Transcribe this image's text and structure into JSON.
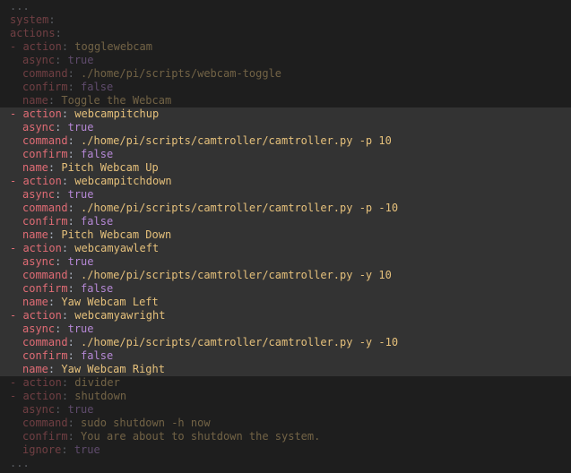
{
  "colors": {
    "background": "#1e1e1e",
    "highlight": "#333333",
    "key": "#e06c75",
    "string": "#e5c07b",
    "boolean": "#b688d6",
    "punctuation": "#abb2bf"
  },
  "lines": [
    {
      "kind": "plain",
      "text": "...",
      "dim": true
    },
    {
      "kind": "key",
      "indent": 0,
      "dash": false,
      "key": "system",
      "value": "",
      "vtype": "none",
      "dim": true
    },
    {
      "kind": "key",
      "indent": 0,
      "dash": false,
      "key": "actions",
      "value": "",
      "vtype": "none",
      "dim": true
    },
    {
      "kind": "key",
      "indent": 0,
      "dash": true,
      "key": "action",
      "value": "togglewebcam",
      "vtype": "string",
      "dim": true
    },
    {
      "kind": "key",
      "indent": 1,
      "dash": false,
      "key": "async",
      "value": "true",
      "vtype": "bool",
      "dim": true
    },
    {
      "kind": "key",
      "indent": 1,
      "dash": false,
      "key": "command",
      "value": "./home/pi/scripts/webcam-toggle",
      "vtype": "string",
      "dim": true
    },
    {
      "kind": "key",
      "indent": 1,
      "dash": false,
      "key": "confirm",
      "value": "false",
      "vtype": "bool",
      "dim": true
    },
    {
      "kind": "key",
      "indent": 1,
      "dash": false,
      "key": "name",
      "value": "Toggle the Webcam",
      "vtype": "string",
      "dim": true
    },
    {
      "kind": "key",
      "indent": 0,
      "dash": true,
      "key": "action",
      "value": "webcampitchup",
      "vtype": "string",
      "hl": true
    },
    {
      "kind": "key",
      "indent": 1,
      "dash": false,
      "key": "async",
      "value": "true",
      "vtype": "bool",
      "hl": true
    },
    {
      "kind": "key",
      "indent": 1,
      "dash": false,
      "key": "command",
      "value": "./home/pi/scripts/camtroller/camtroller.py -p 10",
      "vtype": "string",
      "hl": true
    },
    {
      "kind": "key",
      "indent": 1,
      "dash": false,
      "key": "confirm",
      "value": "false",
      "vtype": "bool",
      "hl": true
    },
    {
      "kind": "key",
      "indent": 1,
      "dash": false,
      "key": "name",
      "value": "Pitch Webcam Up",
      "vtype": "string",
      "hl": true
    },
    {
      "kind": "key",
      "indent": 0,
      "dash": true,
      "key": "action",
      "value": "webcampitchdown",
      "vtype": "string",
      "hl": true
    },
    {
      "kind": "key",
      "indent": 1,
      "dash": false,
      "key": "async",
      "value": "true",
      "vtype": "bool",
      "hl": true
    },
    {
      "kind": "key",
      "indent": 1,
      "dash": false,
      "key": "command",
      "value": "./home/pi/scripts/camtroller/camtroller.py -p -10",
      "vtype": "string",
      "hl": true
    },
    {
      "kind": "key",
      "indent": 1,
      "dash": false,
      "key": "confirm",
      "value": "false",
      "vtype": "bool",
      "hl": true
    },
    {
      "kind": "key",
      "indent": 1,
      "dash": false,
      "key": "name",
      "value": "Pitch Webcam Down",
      "vtype": "string",
      "hl": true
    },
    {
      "kind": "key",
      "indent": 0,
      "dash": true,
      "key": "action",
      "value": "webcamyawleft",
      "vtype": "string",
      "hl": true
    },
    {
      "kind": "key",
      "indent": 1,
      "dash": false,
      "key": "async",
      "value": "true",
      "vtype": "bool",
      "hl": true
    },
    {
      "kind": "key",
      "indent": 1,
      "dash": false,
      "key": "command",
      "value": "./home/pi/scripts/camtroller/camtroller.py -y 10",
      "vtype": "string",
      "hl": true
    },
    {
      "kind": "key",
      "indent": 1,
      "dash": false,
      "key": "confirm",
      "value": "false",
      "vtype": "bool",
      "hl": true
    },
    {
      "kind": "key",
      "indent": 1,
      "dash": false,
      "key": "name",
      "value": "Yaw Webcam Left",
      "vtype": "string",
      "hl": true
    },
    {
      "kind": "key",
      "indent": 0,
      "dash": true,
      "key": "action",
      "value": "webcamyawright",
      "vtype": "string",
      "hl": true
    },
    {
      "kind": "key",
      "indent": 1,
      "dash": false,
      "key": "async",
      "value": "true",
      "vtype": "bool",
      "hl": true
    },
    {
      "kind": "key",
      "indent": 1,
      "dash": false,
      "key": "command",
      "value": "./home/pi/scripts/camtroller/camtroller.py -y -10",
      "vtype": "string",
      "hl": true
    },
    {
      "kind": "key",
      "indent": 1,
      "dash": false,
      "key": "confirm",
      "value": "false",
      "vtype": "bool",
      "hl": true
    },
    {
      "kind": "key",
      "indent": 1,
      "dash": false,
      "key": "name",
      "value": "Yaw Webcam Right",
      "vtype": "string",
      "hl": true
    },
    {
      "kind": "key",
      "indent": 0,
      "dash": true,
      "key": "action",
      "value": "divider",
      "vtype": "string",
      "dim": true
    },
    {
      "kind": "key",
      "indent": 0,
      "dash": true,
      "key": "action",
      "value": "shutdown",
      "vtype": "string",
      "dim": true
    },
    {
      "kind": "key",
      "indent": 1,
      "dash": false,
      "key": "async",
      "value": "true",
      "vtype": "bool",
      "dim": true
    },
    {
      "kind": "key",
      "indent": 1,
      "dash": false,
      "key": "command",
      "value": "sudo shutdown -h now",
      "vtype": "string",
      "dim": true
    },
    {
      "kind": "key",
      "indent": 1,
      "dash": false,
      "key": "confirm",
      "value": "You are about to shutdown the system.",
      "vtype": "string",
      "dim": true
    },
    {
      "kind": "key",
      "indent": 1,
      "dash": false,
      "key": "ignore",
      "value": "true",
      "vtype": "bool",
      "dim": true
    },
    {
      "kind": "plain",
      "text": "...",
      "dim": true
    }
  ]
}
